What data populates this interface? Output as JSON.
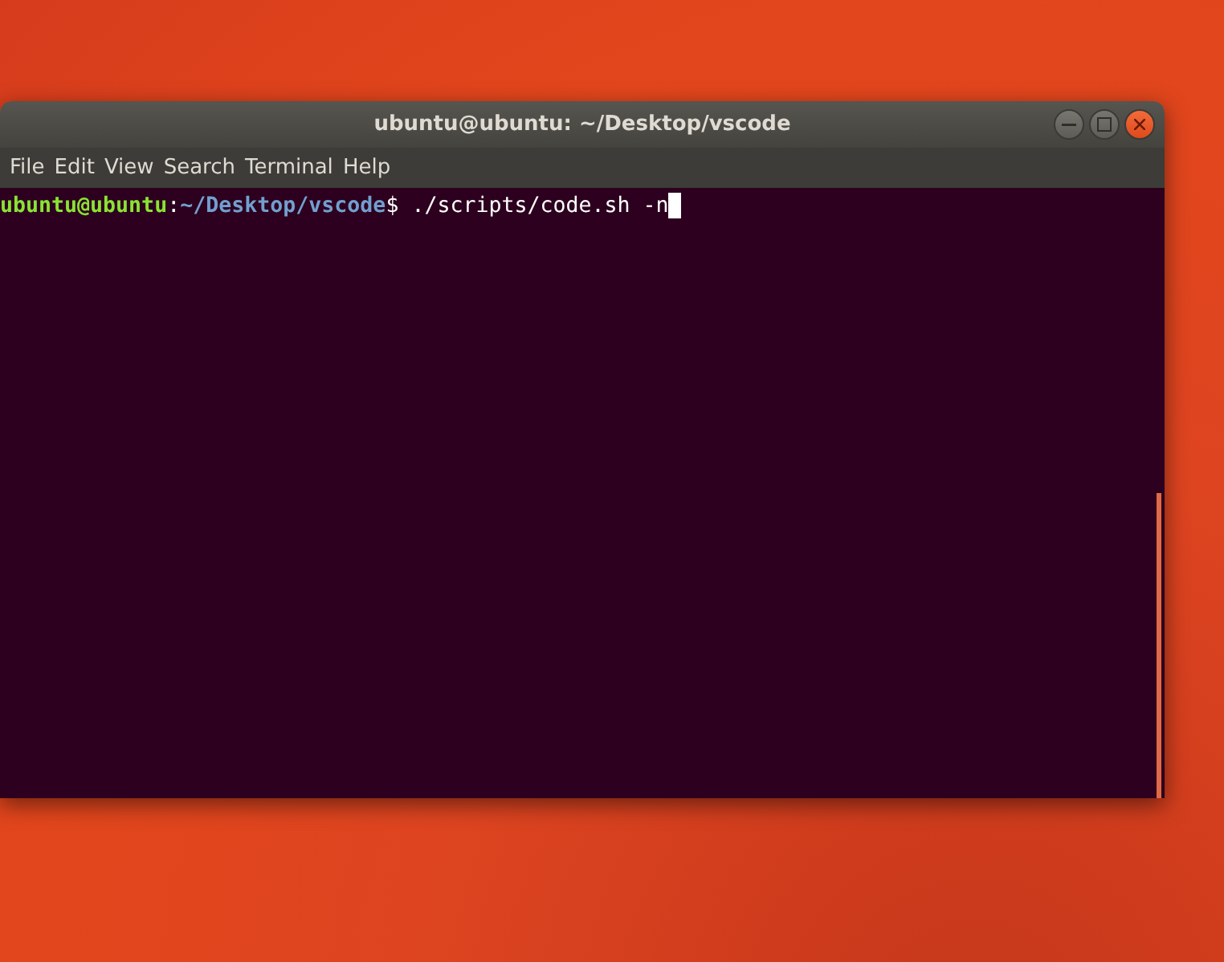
{
  "window": {
    "title": "ubuntu@ubuntu: ~/Desktop/vscode"
  },
  "menu": [
    "File",
    "Edit",
    "View",
    "Search",
    "Terminal",
    "Help"
  ],
  "terminal": {
    "lines": [
      {
        "user": "ubuntu@ubuntu",
        "separator": ":",
        "path": "~/Desktop/vscode",
        "prompt": "$",
        "command": " ./scripts/code.sh -n"
      }
    ]
  }
}
